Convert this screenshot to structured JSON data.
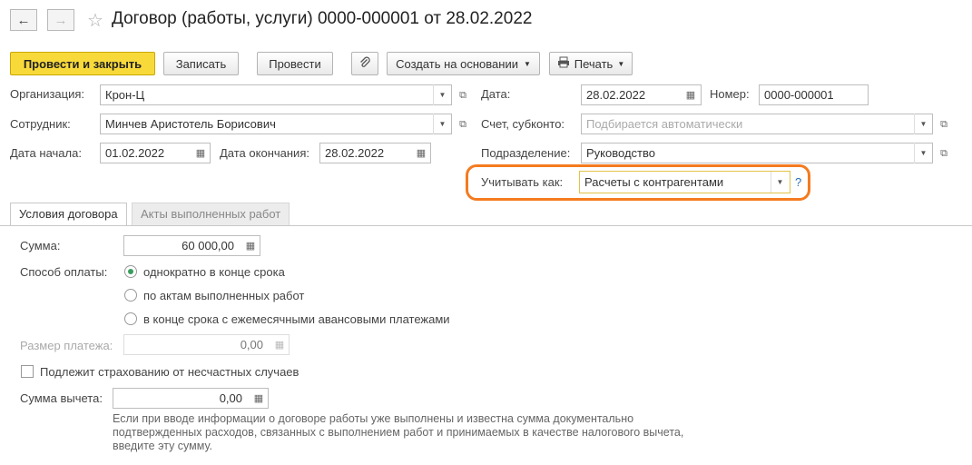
{
  "nav": {
    "back_icon": "arrow-left-icon",
    "forward_icon": "arrow-right-icon",
    "favorite_icon": "star-icon"
  },
  "document": {
    "title": "Договор (работы, услуги) 0000-000001 от 28.02.2022"
  },
  "toolbar": {
    "post_close_label": "Провести и закрыть",
    "save_label": "Записать",
    "post_label": "Провести",
    "attach_icon": "paperclip-icon",
    "create_based_label": "Создать на основании",
    "print_label": "Печать"
  },
  "header": {
    "organization_label": "Организация:",
    "organization_value": "Крон-Ц",
    "employee_label": "Сотрудник:",
    "employee_value": "Минчев Аристотель Борисович",
    "start_date_label": "Дата начала:",
    "start_date_value": "01.02.2022",
    "end_date_label": "Дата окончания:",
    "end_date_value": "28.02.2022",
    "date_label": "Дата:",
    "date_value": "28.02.2022",
    "number_label": "Номер:",
    "number_value": "0000-000001",
    "account_label": "Счет, субконто:",
    "account_placeholder": "Подбирается автоматически",
    "department_label": "Подразделение:",
    "department_value": "Руководство",
    "account_as_label": "Учитывать как:",
    "account_as_value": "Расчеты с контрагентами",
    "help_label": "?"
  },
  "tabs": [
    {
      "label": "Условия договора",
      "active": true
    },
    {
      "label": "Акты выполненных работ",
      "active": false
    }
  ],
  "terms": {
    "sum_label": "Сумма:",
    "sum_value": "60 000,00",
    "payment_method_label": "Способ оплаты:",
    "payment_options": [
      {
        "label": "однократно в конце срока",
        "selected": true
      },
      {
        "label": "по актам выполненных работ",
        "selected": false
      },
      {
        "label": "в конце срока с ежемесячными авансовыми платежами",
        "selected": false
      }
    ],
    "payment_size_label": "Размер платежа:",
    "payment_size_value": "0,00",
    "insurance_label": "Подлежит страхованию от несчастных случаев",
    "insurance_checked": false,
    "deduction_label": "Сумма вычета:",
    "deduction_value": "0,00",
    "deduction_hint": "Если при вводе информации о договоре работы уже выполнены и известна сумма документально подтвержденных расходов, связанных с выполнением работ и принимаемых в качестве налогового вычета, введите эту сумму."
  },
  "colors": {
    "primary_button": "#f8d93a",
    "highlight": "#f47b20",
    "radio_selected": "#3a9d5d"
  }
}
